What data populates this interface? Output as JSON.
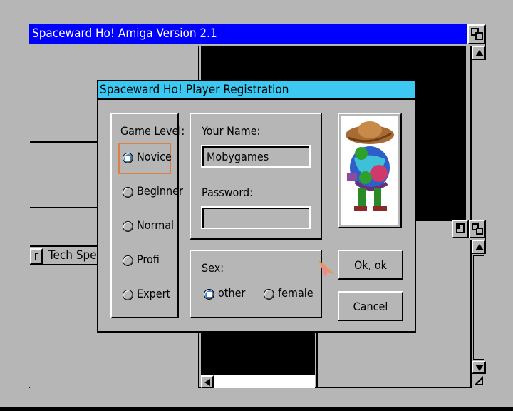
{
  "main_window": {
    "title": "Spaceward Ho! Amiga Version 2.1"
  },
  "tech_window": {
    "title": "Tech Spend"
  },
  "dialog": {
    "title": "Spaceward Ho! Player Registration",
    "game_level": {
      "label": "Game Level:",
      "options": [
        {
          "label": "Novice",
          "selected": true
        },
        {
          "label": "Beginner",
          "selected": false
        },
        {
          "label": "Normal",
          "selected": false
        },
        {
          "label": "Profi",
          "selected": false
        },
        {
          "label": "Expert",
          "selected": false
        }
      ]
    },
    "name_label": "Your Name:",
    "name_value": "Mobygames",
    "password_label": "Password:",
    "password_value": "",
    "sex": {
      "label": "Sex:",
      "options": [
        {
          "label": "other",
          "selected": true
        },
        {
          "label": "female",
          "selected": false
        }
      ]
    },
    "ok_label": "Ok, ok",
    "cancel_label": "Cancel"
  },
  "colors": {
    "desktop_gray": "#b6b6b6",
    "title_blue": "#0000ff",
    "dialog_title_cyan": "#3cc8f0",
    "accent_radio": "#3e82c8",
    "focus_orange": "#e08040"
  },
  "icons": [
    "depth-gadget-icon",
    "scroll-up-arrow-icon",
    "scroll-down-arrow-icon",
    "scroll-left-arrow-icon",
    "resize-gadget-icon",
    "zoom-gadget-icon",
    "close-gadget-icon",
    "mouse-pointer-icon",
    "player-avatar-icon"
  ]
}
